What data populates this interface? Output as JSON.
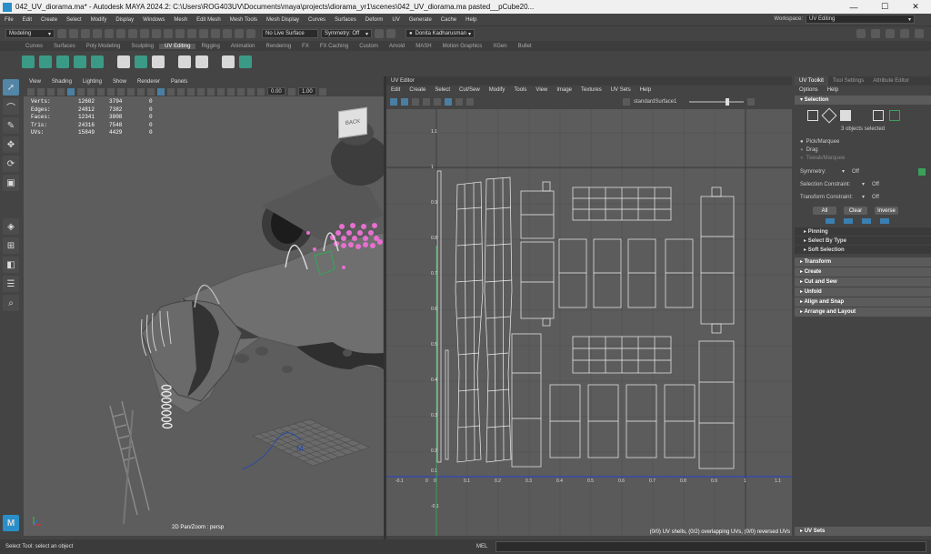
{
  "window": {
    "title": "042_UV_diorama.ma* - Autodesk MAYA 2024.2: C:\\Users\\ROG403UV\\Documents\\maya\\projects\\diorama_yr1\\scenes\\042_UV_diorama.ma       pasted__pCube20...",
    "controls": [
      "—",
      "☐",
      "✕"
    ]
  },
  "menubar": {
    "items": [
      "File",
      "Edit",
      "Create",
      "Select",
      "Modify",
      "Display",
      "Windows",
      "Mesh",
      "Edit Mesh",
      "Mesh Tools",
      "Mesh Display",
      "Curves",
      "Surfaces",
      "Deform",
      "UV",
      "Generate",
      "Cache",
      "Help"
    ],
    "workspace_label": "Workspace:",
    "workspace_value": "UV Editing"
  },
  "statusline": {
    "mode": "Modeling",
    "live_surface": "No Live Surface",
    "symmetry": "Symmetry: Off",
    "user": "Donita Kadharusman"
  },
  "shelf_tabs": [
    "Curves",
    "Surfaces",
    "Poly Modeling",
    "Sculpting",
    "UV Editing",
    "Rigging",
    "Animation",
    "Rendering",
    "FX",
    "FX Caching",
    "Custom",
    "Arnold",
    "MASH",
    "Motion Graphics",
    "XGen",
    "Bullet"
  ],
  "shelf_active": "UV Editing",
  "viewport": {
    "menu": [
      "View",
      "Shading",
      "Lighting",
      "Show",
      "Renderer",
      "Panels"
    ],
    "field1": "0.00",
    "field2": "1.00",
    "hud": [
      {
        "label": "Verts:",
        "a": "12602",
        "b": "3794",
        "c": "0"
      },
      {
        "label": "Edges:",
        "a": "24812",
        "b": "7382",
        "c": "0"
      },
      {
        "label": "Faces:",
        "a": "12341",
        "b": "3808",
        "c": "0"
      },
      {
        "label": "Tris:",
        "a": "24316",
        "b": "7548",
        "c": "0"
      },
      {
        "label": "UVs:",
        "a": "15849",
        "b": "4429",
        "c": "0"
      }
    ],
    "camera_label": "2D Pan/Zoom : persp",
    "viewcube_text": "BACK"
  },
  "uv_editor": {
    "title": "UV Editor",
    "menu": [
      "Edit",
      "Create",
      "Select",
      "Cut/Sew",
      "Modify",
      "Tools",
      "View",
      "Image",
      "Textures",
      "UV Sets",
      "Help"
    ],
    "uv_set": "standardSurface1",
    "x_ticks": [
      "-0.1",
      "0",
      "0.1",
      "0.2",
      "0.3",
      "0.4",
      "0.5",
      "0.6",
      "0.7",
      "0.8",
      "0.9",
      "1",
      "1.1"
    ],
    "y_ticks": [
      "1.1",
      "1",
      "0.9",
      "0.8",
      "0.7",
      "0.6",
      "0.5",
      "0.4",
      "0.3",
      "0.2",
      "0.1",
      "0",
      "-0.1"
    ],
    "status": "(0/0) UV shells, (0/2) overlapping UVs, (0/0) reversed UVs"
  },
  "right_panel": {
    "tabs": [
      "UV Toolkit",
      "Tool Settings",
      "Attribute Editor"
    ],
    "menu": [
      "Options",
      "Help"
    ],
    "selection_header": "Selection",
    "objects_selected": "3 objects selected",
    "pick_options": [
      "Pick/Marquee",
      "Drag",
      "Tweak/Marquee"
    ],
    "symmetry_label": "Symmetry:",
    "symmetry_value": "Off",
    "selection_constraint_label": "Selection Constraint:",
    "selection_constraint_value": "Off",
    "transform_constraint_label": "Transform Constraint:",
    "transform_constraint_value": "Off",
    "buttons": [
      "All",
      "Clear",
      "Inverse"
    ],
    "subsections": [
      "Pinning",
      "Select By Type",
      "Soft Selection"
    ],
    "sections": [
      "Transform",
      "Create",
      "Cut and Sew",
      "Unfold",
      "Align and Snap",
      "Arrange and Layout"
    ],
    "uv_sets": "UV Sets"
  },
  "helpline": {
    "text": "Select Tool: select an object",
    "mel": "MEL"
  },
  "colors": {
    "accent": "#5285a6",
    "shelf_icon": "#3b9a86",
    "uv_wire": "#ffffff"
  }
}
